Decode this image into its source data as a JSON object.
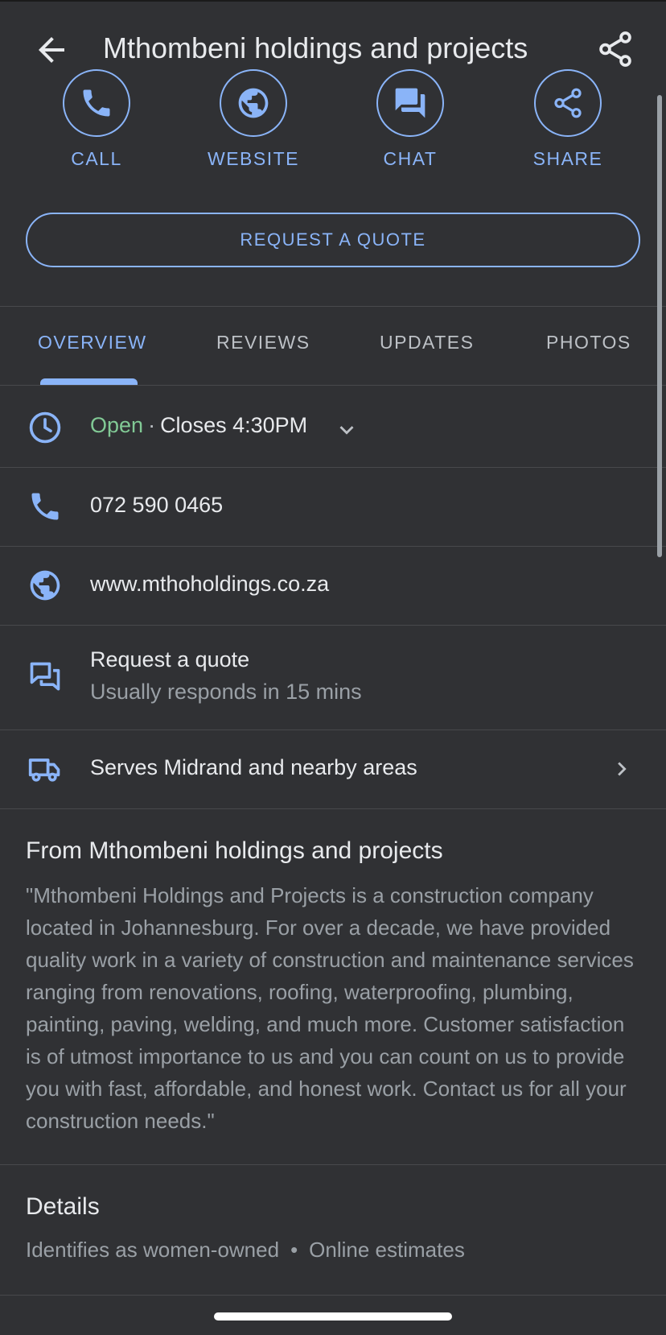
{
  "header": {
    "title": "Mthombeni holdings and projects",
    "back_icon": "arrow-left-icon",
    "share_icon": "share-icon"
  },
  "actions": [
    {
      "label": "CALL",
      "icon": "phone-icon"
    },
    {
      "label": "WEBSITE",
      "icon": "globe-icon"
    },
    {
      "label": "CHAT",
      "icon": "chat-icon"
    },
    {
      "label": "SHARE",
      "icon": "share-icon"
    }
  ],
  "quote_button": "REQUEST A QUOTE",
  "tabs": [
    {
      "label": "OVERVIEW",
      "active": true
    },
    {
      "label": "REVIEWS",
      "active": false
    },
    {
      "label": "UPDATES",
      "active": false
    },
    {
      "label": "PHOTOS",
      "active": false
    }
  ],
  "hours": {
    "status": "Open",
    "separator": "·",
    "closes": "Closes 4:30PM"
  },
  "phone": "072 590 0465",
  "website": "www.mthoholdings.co.za",
  "quote_row": {
    "title": "Request a quote",
    "subtitle": "Usually responds in 15 mins"
  },
  "service_area": "Serves Midrand and nearby areas",
  "from_business": {
    "title": "From Mthombeni holdings and projects",
    "description": "\"Mthombeni Holdings and Projects is a construction company located in Johannesburg. For over a decade, we have provided quality work in a variety of construction and maintenance services ranging from renovations, roofing, waterproofing, plumbing, painting, paving, welding, and much more. Customer satisfaction is of utmost importance to us and you can count on us to provide you with fast, affordable, and honest work. Contact us for all your construction needs.\""
  },
  "details": {
    "title": "Details",
    "items": [
      "Identifies as women-owned",
      "Online estimates"
    ],
    "separator": "•"
  },
  "colors": {
    "background": "#303134",
    "accent": "#8ab4f8",
    "open_green": "#81c995",
    "text": "#e8eaed",
    "muted": "#9aa0a6"
  }
}
